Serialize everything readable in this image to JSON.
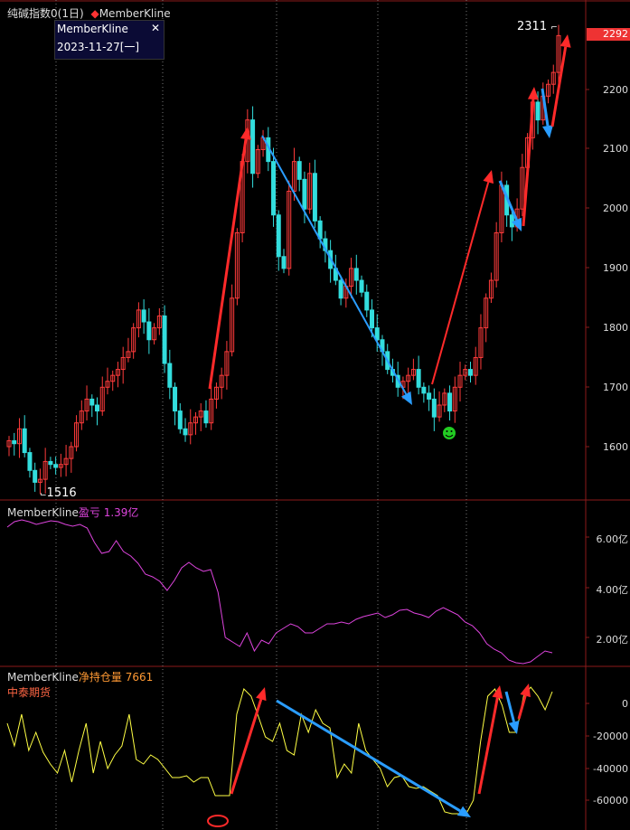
{
  "main": {
    "title": "纯碱指数0(1日)",
    "indicator": "MemberKline",
    "indicator_color": "#ff3333",
    "tooltip": {
      "title": "MemberKline",
      "date": "2023-11-27[一]"
    },
    "high_label": "2311",
    "low_label": "1516",
    "current_price": "2292",
    "y_ticks": [
      "2200",
      "2100",
      "2000",
      "1900",
      "1800",
      "1700",
      "1600"
    ]
  },
  "panel2": {
    "title": "MemberKline",
    "series_label": "盈亏 1.39亿",
    "series_color": "#dd44dd",
    "y_ticks": [
      "6.00亿",
      "4.00亿",
      "2.00亿"
    ]
  },
  "panel3": {
    "title": "MemberKline",
    "series_label": "净持仓量 7661",
    "series_color": "#ff9933",
    "member": "中泰期货",
    "y_ticks": [
      "0",
      "-20000",
      "-40000",
      "-60000"
    ]
  },
  "colors": {
    "up": "#ff3b3b",
    "down": "#33dddd",
    "arrow_up": "#ff2a2a",
    "arrow_down": "#2a9dff",
    "grid": "#8b1a1a",
    "yellow_line": "#ffff44",
    "smile": "#22cc22"
  }
}
